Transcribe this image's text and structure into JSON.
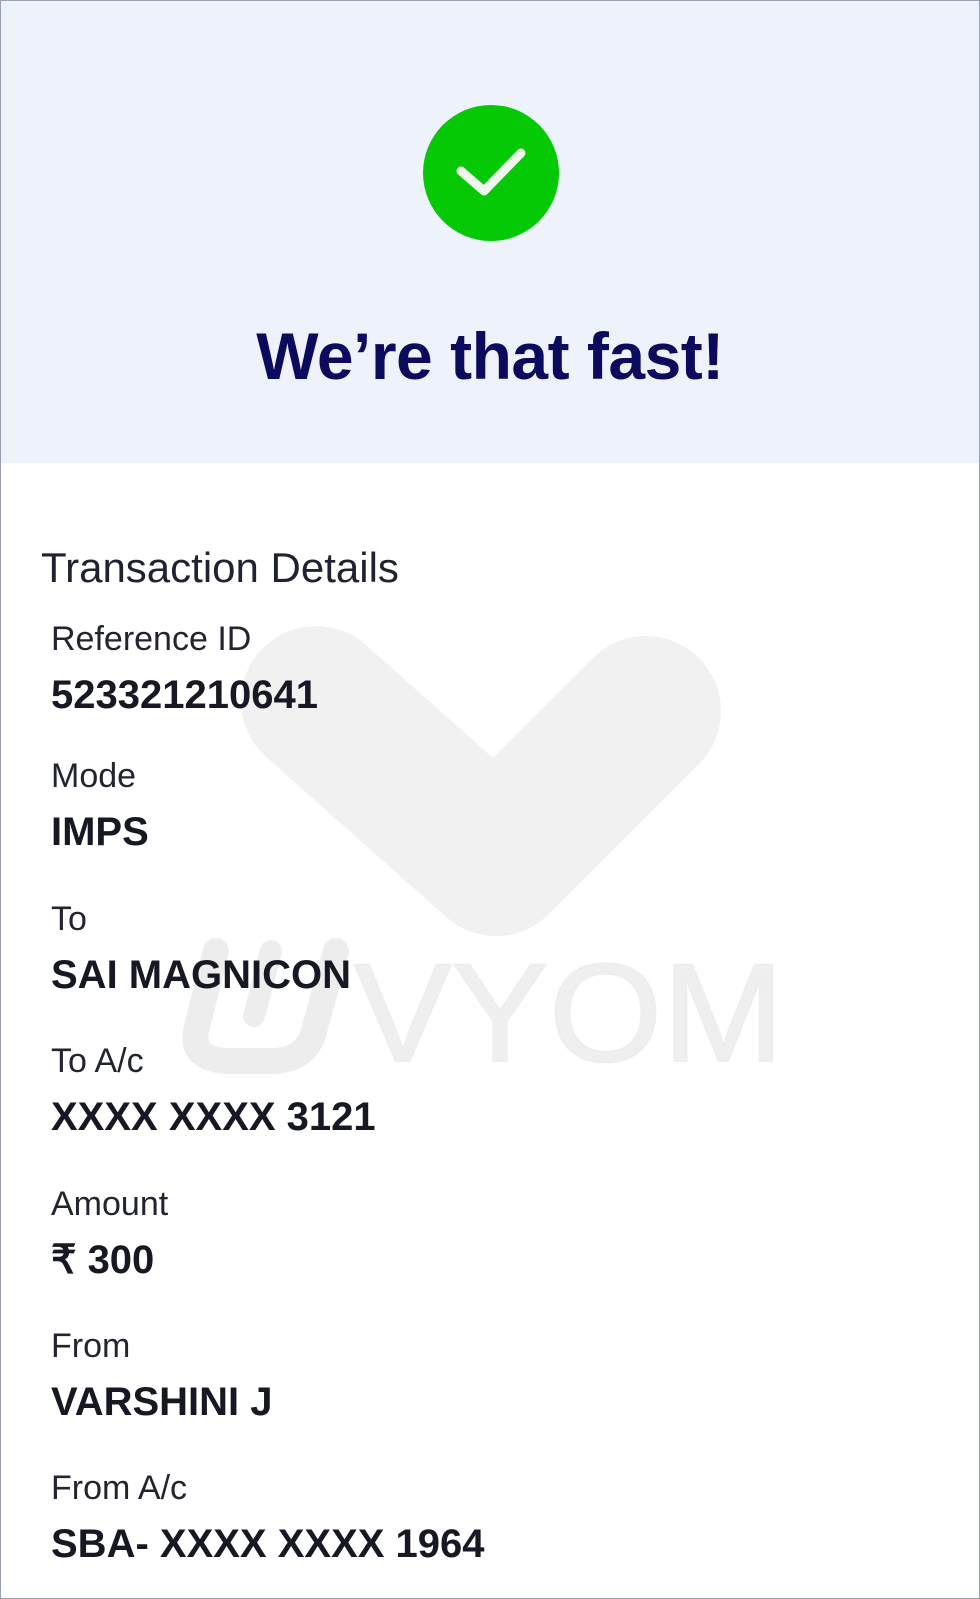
{
  "hero": {
    "status_icon": "check-icon",
    "title": "We’re that fast!",
    "success_color": "#05c905",
    "title_color": "#0b0a5c"
  },
  "watermark": {
    "text": "VYOM",
    "icon": "check-watermark-icon"
  },
  "transaction": {
    "title": "Transaction Details",
    "fields": [
      {
        "label": "Reference ID",
        "value": "523321210641"
      },
      {
        "label": "Mode",
        "value": "IMPS"
      },
      {
        "label": "To",
        "value": "SAI MAGNICON"
      },
      {
        "label": "To A/c",
        "value": "XXXX XXXX 3121"
      },
      {
        "label": "Amount",
        "value": "₹ 300"
      },
      {
        "label": "From",
        "value": "VARSHINI J"
      },
      {
        "label": "From A/c",
        "value": "SBA- XXXX XXXX 1964"
      }
    ]
  }
}
